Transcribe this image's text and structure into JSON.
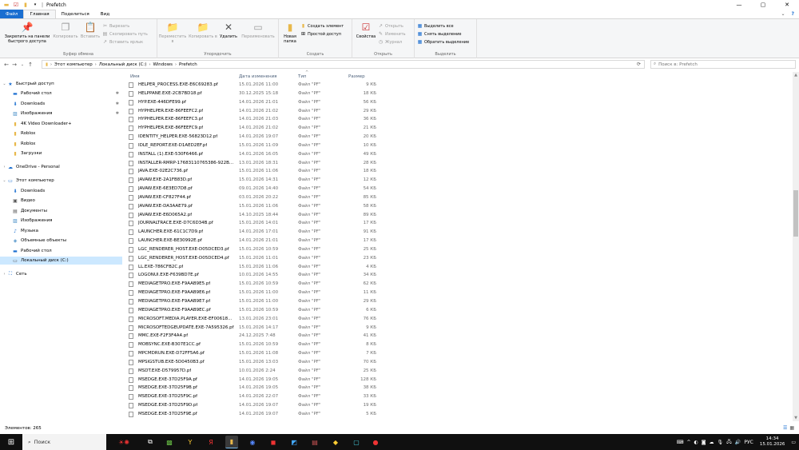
{
  "window": {
    "title": "Prefetch",
    "controls": {
      "minimize": "—",
      "maximize": "▢",
      "close": "✕"
    }
  },
  "ribbon_tabs": {
    "file": "Файл",
    "home": "Главная",
    "share": "Поделиться",
    "view": "Вид"
  },
  "ribbon": {
    "clipboard": {
      "label": "Буфер обмена",
      "pin": "Закрепить на панели быстрого доступа",
      "copy": "Копировать",
      "paste": "Вставить",
      "cut": "Вырезать",
      "copy_path": "Скопировать путь",
      "paste_shortcut": "Вставить ярлык"
    },
    "organize": {
      "label": "Упорядочить",
      "move_to": "Переместить в",
      "copy_to": "Копировать в",
      "delete": "Удалить",
      "rename": "Переименовать"
    },
    "new": {
      "label": "Создать",
      "new_folder": "Новая папка",
      "new_item": "Создать элемент",
      "easy_access": "Простой доступ"
    },
    "open": {
      "label": "Открыть",
      "properties": "Свойства",
      "open": "Открыть",
      "edit": "Изменить",
      "history": "Журнал"
    },
    "select": {
      "label": "Выделить",
      "select_all": "Выделить все",
      "select_none": "Снять выделение",
      "invert": "Обратить выделение"
    }
  },
  "address": {
    "crumbs": [
      "Этот компьютер",
      "Локальный диск (C:)",
      "Windows",
      "Prefetch"
    ],
    "search_placeholder": "Поиск в: Prefetch"
  },
  "nav": {
    "quick_access": "Быстрый доступ",
    "desktop": "Рабочий стол",
    "downloads": "Загрузки",
    "downloads_ru": "Downloads",
    "pictures": "Изображения",
    "video_dl": "4K Video Downloader+",
    "roblox1": "Roblox",
    "roblox2": "Roblox",
    "onedrive": "OneDrive - Personal",
    "this_pc": "Этот компьютер",
    "pc_downloads": "Downloads",
    "video": "Видео",
    "documents": "Документы",
    "pc_pictures": "Изображения",
    "music": "Музыка",
    "objects3d": "Объемные объекты",
    "pc_desktop": "Рабочий стол",
    "local_disk": "Локальный диск (C:)",
    "network": "Сеть"
  },
  "columns": {
    "name": "Имя",
    "date": "Дата изменения",
    "type": "Тип",
    "size": "Размер"
  },
  "files": [
    {
      "name": "HELPER_PROCESS.EXE-E6C69283.pf",
      "date": "15.01.2026 11:00",
      "type": "Файл \"PF\"",
      "size": "9 КБ"
    },
    {
      "name": "HELPPANE.EXE-2CB7BD18.pf",
      "date": "30.12.2025 15:18",
      "type": "Файл \"PF\"",
      "size": "18 КБ"
    },
    {
      "name": "HYP.EXE-446DFE99.pf",
      "date": "14.01.2026 21:01",
      "type": "Файл \"PF\"",
      "size": "56 КБ"
    },
    {
      "name": "HYPHELPER.EXE-86FEEFC2.pf",
      "date": "14.01.2026 21:02",
      "type": "Файл \"PF\"",
      "size": "29 КБ"
    },
    {
      "name": "HYPHELPER.EXE-86FEEFC3.pf",
      "date": "14.01.2026 21:03",
      "type": "Файл \"PF\"",
      "size": "36 КБ"
    },
    {
      "name": "HYPHELPER.EXE-86FEEFC9.pf",
      "date": "14.01.2026 21:02",
      "type": "Файл \"PF\"",
      "size": "21 КБ"
    },
    {
      "name": "IDENTITY_HELPER.EXE-56823D12.pf",
      "date": "14.01.2026 19:07",
      "type": "Файл \"PF\"",
      "size": "20 КБ"
    },
    {
      "name": "IDLE_REPORT.EXE-D1AED2EF.pf",
      "date": "15.01.2026 11:09",
      "type": "Файл \"PF\"",
      "size": "10 КБ"
    },
    {
      "name": "INSTALL (1).EXE-530F6466.pf",
      "date": "14.01.2026 16:05",
      "type": "Файл \"PF\"",
      "size": "49 КБ"
    },
    {
      "name": "INSTALLER-RMRP-17683110765386-922B...",
      "date": "13.01.2026 18:31",
      "type": "Файл \"PF\"",
      "size": "28 КБ"
    },
    {
      "name": "JAVA.EXE-02E2C736.pf",
      "date": "15.01.2026 11:06",
      "type": "Файл \"PF\"",
      "size": "18 КБ"
    },
    {
      "name": "JAVAW.EXE-2A1FB83D.pf",
      "date": "15.01.2026 14:31",
      "type": "Файл \"PF\"",
      "size": "12 КБ"
    },
    {
      "name": "JAVAW.EXE-6E3ED7D8.pf",
      "date": "09.01.2026 14:40",
      "type": "Файл \"PF\"",
      "size": "54 КБ"
    },
    {
      "name": "JAVAW.EXE-CF827F44.pf",
      "date": "03.01.2026 20:22",
      "type": "Файл \"PF\"",
      "size": "85 КБ"
    },
    {
      "name": "JAVAW.EXE-DA3AAE79.pf",
      "date": "15.01.2026 11:06",
      "type": "Файл \"PF\"",
      "size": "58 КБ"
    },
    {
      "name": "JAVAW.EXE-E6D065A2.pf",
      "date": "14.10.2025 18:44",
      "type": "Файл \"PF\"",
      "size": "89 КБ"
    },
    {
      "name": "JOURNALTRACE.EXE-D7C6D34B.pf",
      "date": "15.01.2026 14:01",
      "type": "Файл \"PF\"",
      "size": "17 КБ"
    },
    {
      "name": "LAUNCHER.EXE-61C1C7D9.pf",
      "date": "14.01.2026 17:01",
      "type": "Файл \"PF\"",
      "size": "91 КБ"
    },
    {
      "name": "LAUNCHER.EXE-BE30992E.pf",
      "date": "14.01.2026 21:01",
      "type": "Файл \"PF\"",
      "size": "17 КБ"
    },
    {
      "name": "LGC_RENDERER_HOST.EXE-D05DCED3.pf",
      "date": "15.01.2026 10:59",
      "type": "Файл \"PF\"",
      "size": "25 КБ"
    },
    {
      "name": "LGC_RENDERER_HOST.EXE-D05DCED4.pf",
      "date": "15.01.2026 11:01",
      "type": "Файл \"PF\"",
      "size": "23 КБ"
    },
    {
      "name": "LL.EXE-786CFB2C.pf",
      "date": "15.01.2026 11:06",
      "type": "Файл \"PF\"",
      "size": "4 КБ"
    },
    {
      "name": "LOGONUI.EXE-F639BD7E.pf",
      "date": "10.01.2026 14:55",
      "type": "Файл \"PF\"",
      "size": "34 КБ"
    },
    {
      "name": "MEDIAGETPRO.EXE-F9AAB9E5.pf",
      "date": "15.01.2026 10:59",
      "type": "Файл \"PF\"",
      "size": "62 КБ"
    },
    {
      "name": "MEDIAGETPRO.EXE-F9AAB9E6.pf",
      "date": "15.01.2026 11:00",
      "type": "Файл \"PF\"",
      "size": "11 КБ"
    },
    {
      "name": "MEDIAGETPRO.EXE-F9AAB9E7.pf",
      "date": "15.01.2026 11:00",
      "type": "Файл \"PF\"",
      "size": "29 КБ"
    },
    {
      "name": "MEDIAGETPRO.EXE-F9AAB9EC.pf",
      "date": "15.01.2026 10:59",
      "type": "Файл \"PF\"",
      "size": "6 КБ"
    },
    {
      "name": "MICROSOFT.MEDIA.PLAYER.EXE-EF00618...",
      "date": "13.01.2026 23:01",
      "type": "Файл \"PF\"",
      "size": "76 КБ"
    },
    {
      "name": "MICROSOFTEDGEUPDATE.EXE-7A595326.pf",
      "date": "15.01.2026 14:17",
      "type": "Файл \"PF\"",
      "size": "9 КБ"
    },
    {
      "name": "MMC.EXE-F2F3F4A4.pf",
      "date": "24.12.2025 7:48",
      "type": "Файл \"PF\"",
      "size": "41 КБ"
    },
    {
      "name": "MOBSYNC.EXE-B307E1CC.pf",
      "date": "15.01.2026 10:59",
      "type": "Файл \"PF\"",
      "size": "8 КБ"
    },
    {
      "name": "MPCMDRUN.EXE-D72FF5A6.pf",
      "date": "15.01.2026 11:08",
      "type": "Файл \"PF\"",
      "size": "7 КБ"
    },
    {
      "name": "MPSIGSTUB.EXE-5D0450B3.pf",
      "date": "15.01.2026 13:03",
      "type": "Файл \"PF\"",
      "size": "70 КБ"
    },
    {
      "name": "MSDT.EXE-D579957D.pf",
      "date": "10.01.2026 2:24",
      "type": "Файл \"PF\"",
      "size": "25 КБ"
    },
    {
      "name": "MSEDGE.EXE-37D25F9A.pf",
      "date": "14.01.2026 19:05",
      "type": "Файл \"PF\"",
      "size": "128 КБ"
    },
    {
      "name": "MSEDGE.EXE-37D25F9B.pf",
      "date": "14.01.2026 19:05",
      "type": "Файл \"PF\"",
      "size": "38 КБ"
    },
    {
      "name": "MSEDGE.EXE-37D25F9C.pf",
      "date": "14.01.2026 22:07",
      "type": "Файл \"PF\"",
      "size": "33 КБ"
    },
    {
      "name": "MSEDGE.EXE-37D25F9D.pf",
      "date": "14.01.2026 19:07",
      "type": "Файл \"PF\"",
      "size": "19 КБ"
    },
    {
      "name": "MSEDGE.EXE-37D25F9E.pf",
      "date": "14.01.2026 19:07",
      "type": "Файл \"PF\"",
      "size": "5 КБ"
    }
  ],
  "status": {
    "count": "Элементов: 265"
  },
  "taskbar": {
    "search": "Поиск",
    "lang": "РУС",
    "time": "14:34",
    "date": "15.01.2026"
  },
  "colors": {
    "accent": "#1a6ed0",
    "selection": "#cce8ff",
    "folder": "#e8b84a",
    "taskbar": "#101010"
  }
}
